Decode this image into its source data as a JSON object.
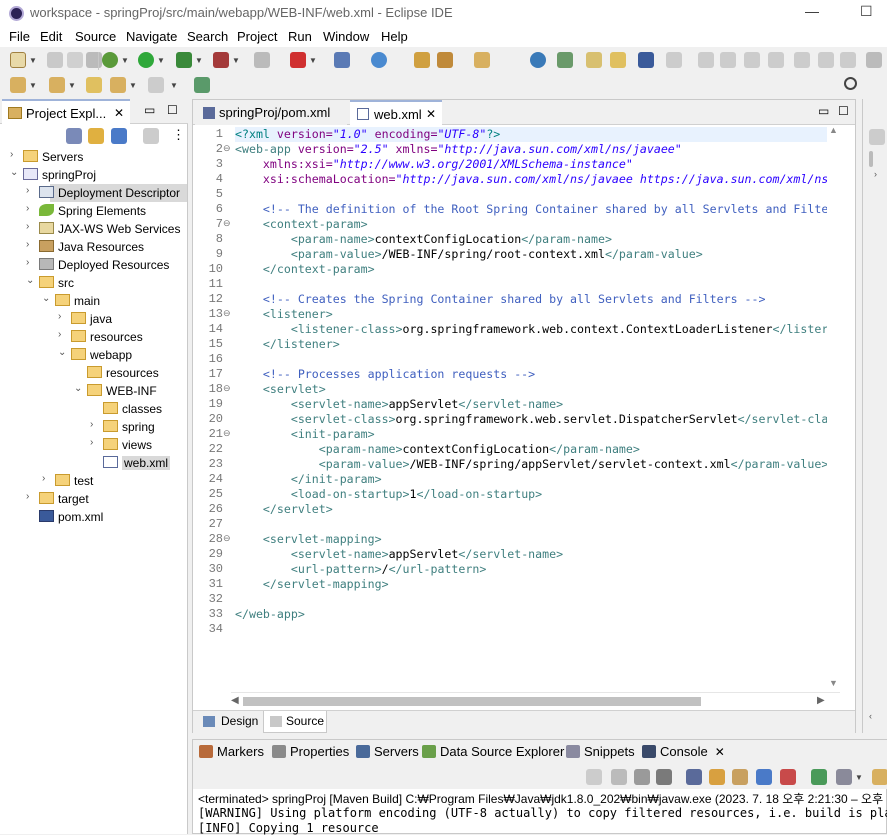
{
  "window": {
    "title": "workspace - springProj/src/main/webapp/WEB-INF/web.xml - Eclipse IDE",
    "minimize": "—",
    "maximize": "☐"
  },
  "menu": [
    "File",
    "Edit",
    "Source",
    "Navigate",
    "Search",
    "Project",
    "Run",
    "Window",
    "Help"
  ],
  "package_explorer": {
    "tab_label": "Project Expl...",
    "tree": [
      {
        "label": "Servers",
        "depth": 0,
        "arrow": "›",
        "icon": "folder"
      },
      {
        "label": "springProj",
        "depth": 0,
        "arrow": "⌄",
        "icon": "project"
      },
      {
        "label": "Deployment Descriptor",
        "depth": 1,
        "arrow": "›",
        "icon": "dd",
        "selected": true
      },
      {
        "label": "Spring Elements",
        "depth": 1,
        "arrow": "›",
        "icon": "spring"
      },
      {
        "label": "JAX-WS Web Services",
        "depth": 1,
        "arrow": "›",
        "icon": "ws"
      },
      {
        "label": "Java Resources",
        "depth": 1,
        "arrow": "›",
        "icon": "jres"
      },
      {
        "label": "Deployed Resources",
        "depth": 1,
        "arrow": "›",
        "icon": "dres"
      },
      {
        "label": "src",
        "depth": 1,
        "arrow": "⌄",
        "icon": "folder"
      },
      {
        "label": "main",
        "depth": 2,
        "arrow": "⌄",
        "icon": "folder"
      },
      {
        "label": "java",
        "depth": 3,
        "arrow": "›",
        "icon": "folder"
      },
      {
        "label": "resources",
        "depth": 3,
        "arrow": "›",
        "icon": "folder"
      },
      {
        "label": "webapp",
        "depth": 3,
        "arrow": "⌄",
        "icon": "folder"
      },
      {
        "label": "resources",
        "depth": 4,
        "arrow": "",
        "icon": "folder"
      },
      {
        "label": "WEB-INF",
        "depth": 4,
        "arrow": "⌄",
        "icon": "folder"
      },
      {
        "label": "classes",
        "depth": 5,
        "arrow": "",
        "icon": "folder"
      },
      {
        "label": "spring",
        "depth": 5,
        "arrow": "›",
        "icon": "folder"
      },
      {
        "label": "views",
        "depth": 5,
        "arrow": "›",
        "icon": "folder"
      },
      {
        "label": "web.xml",
        "depth": 5,
        "arrow": "",
        "icon": "xml",
        "highlight": true
      },
      {
        "label": "test",
        "depth": 2,
        "arrow": "›",
        "icon": "folder"
      },
      {
        "label": "target",
        "depth": 1,
        "arrow": "›",
        "icon": "folder"
      },
      {
        "label": "pom.xml",
        "depth": 1,
        "arrow": "",
        "icon": "pom"
      }
    ]
  },
  "editor": {
    "tabs": [
      {
        "label": "springProj/pom.xml",
        "active": false
      },
      {
        "label": "web.xml",
        "active": true,
        "close": "✕"
      }
    ],
    "fold_lines": [
      2,
      7,
      13,
      18,
      21,
      28
    ],
    "lines": [
      [
        [
          "decl",
          "<?xml "
        ],
        [
          "attr",
          "version="
        ],
        [
          "val",
          "\"1.0\""
        ],
        [
          "attr",
          " encoding="
        ],
        [
          "val",
          "\"UTF-8\""
        ],
        [
          "decl",
          "?>"
        ]
      ],
      [
        [
          "tag",
          "<web-app "
        ],
        [
          "attr",
          "version="
        ],
        [
          "val",
          "\"2.5\""
        ],
        [
          "attr",
          " xmlns="
        ],
        [
          "val",
          "\"http://java.sun.com/xml/ns/javaee\""
        ]
      ],
      [
        [
          "attr",
          "    xmlns:xsi="
        ],
        [
          "val",
          "\"http://www.w3.org/2001/XMLSchema-instance\""
        ]
      ],
      [
        [
          "attr",
          "    xsi:schemaLocation="
        ],
        [
          "val",
          "\"http://java.sun.com/xml/ns/javaee https://java.sun.com/xml/ns"
        ]
      ],
      [],
      [
        [
          "cmt",
          "    <!-- The definition of the Root Spring Container shared by all Servlets and Filte"
        ]
      ],
      [
        [
          "tag",
          "    <context-param>"
        ]
      ],
      [
        [
          "tag",
          "        <param-name>"
        ],
        [
          "txt-c",
          "contextConfigLocation"
        ],
        [
          "tag",
          "</param-name>"
        ]
      ],
      [
        [
          "tag",
          "        <param-value>"
        ],
        [
          "txt-c",
          "/WEB-INF/spring/root-context.xml"
        ],
        [
          "tag",
          "</param-value>"
        ]
      ],
      [
        [
          "tag",
          "    </context-param>"
        ]
      ],
      [],
      [
        [
          "cmt",
          "    <!-- Creates the Spring Container shared by all Servlets and Filters -->"
        ]
      ],
      [
        [
          "tag",
          "    <listener>"
        ]
      ],
      [
        [
          "tag",
          "        <listener-class>"
        ],
        [
          "txt-c",
          "org.springframework.web.context.ContextLoaderListener"
        ],
        [
          "tag",
          "</lister"
        ]
      ],
      [
        [
          "tag",
          "    </listener>"
        ]
      ],
      [],
      [
        [
          "cmt",
          "    <!-- Processes application requests -->"
        ]
      ],
      [
        [
          "tag",
          "    <servlet>"
        ]
      ],
      [
        [
          "tag",
          "        <servlet-name>"
        ],
        [
          "txt-c",
          "appServlet"
        ],
        [
          "tag",
          "</servlet-name>"
        ]
      ],
      [
        [
          "tag",
          "        <servlet-class>"
        ],
        [
          "txt-c",
          "org.springframework.web.servlet.DispatcherServlet"
        ],
        [
          "tag",
          "</servlet-cla"
        ]
      ],
      [
        [
          "tag",
          "        <init-param>"
        ]
      ],
      [
        [
          "tag",
          "            <param-name>"
        ],
        [
          "txt-c",
          "contextConfigLocation"
        ],
        [
          "tag",
          "</param-name>"
        ]
      ],
      [
        [
          "tag",
          "            <param-value>"
        ],
        [
          "txt-c",
          "/WEB-INF/spring/appServlet/servlet-context.xml"
        ],
        [
          "tag",
          "</param-value>"
        ]
      ],
      [
        [
          "tag",
          "        </init-param>"
        ]
      ],
      [
        [
          "tag",
          "        <load-on-startup>"
        ],
        [
          "txt-c",
          "1"
        ],
        [
          "tag",
          "</load-on-startup>"
        ]
      ],
      [
        [
          "tag",
          "    </servlet>"
        ]
      ],
      [],
      [
        [
          "tag",
          "    <servlet-mapping>"
        ]
      ],
      [
        [
          "tag",
          "        <servlet-name>"
        ],
        [
          "txt-c",
          "appServlet"
        ],
        [
          "tag",
          "</servlet-name>"
        ]
      ],
      [
        [
          "tag",
          "        <url-pattern>"
        ],
        [
          "txt-c",
          "/"
        ],
        [
          "tag",
          "</url-pattern>"
        ]
      ],
      [
        [
          "tag",
          "    </servlet-mapping>"
        ]
      ],
      [],
      [
        [
          "tag",
          "</web-app>"
        ]
      ],
      []
    ],
    "bottom_tabs": [
      "Design",
      "Source"
    ],
    "active_bottom_tab": "Source"
  },
  "console_panel": {
    "tabs": [
      "Markers",
      "Properties",
      "Servers",
      "Data Source Explorer",
      "Snippets",
      "Console"
    ],
    "active_tab": "Console",
    "close": "✕",
    "terminated": "<terminated> springProj [Maven Build] C:₩Program Files₩Java₩jdk1.8.0_202₩bin₩javaw.exe  (2023. 7. 18 오후 2:21:30 – 오후",
    "lines": [
      "[WARNING] Using platform encoding (UTF-8 actually) to copy filtered resources, i.e. build is platfo",
      "[INFO] Copying 1 resource"
    ]
  },
  "colors": {
    "tag": "#3f7f7f",
    "attr": "#7f007f",
    "value": "#2a00ff",
    "comment": "#3f5fbf",
    "selection": "#d9d9d9",
    "current_line": "#e8f2fe"
  }
}
